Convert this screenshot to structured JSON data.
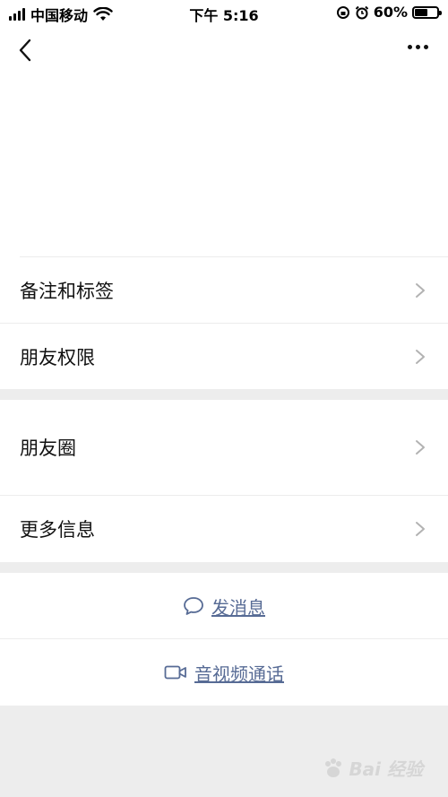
{
  "status_bar": {
    "carrier": "中国移动",
    "time": "下午 5:16",
    "battery": "60%",
    "battery_level": 0.6,
    "icons": [
      "signal-icon",
      "wifi-icon",
      "rotation-lock-icon",
      "alarm-icon",
      "battery-icon"
    ]
  },
  "nav": {
    "back_icon": "chevron-left-icon",
    "more_icon": "more-dots-icon"
  },
  "menu_group_1": [
    {
      "label": "备注和标签"
    },
    {
      "label": "朋友权限"
    }
  ],
  "menu_group_2": [
    {
      "label": "朋友圈"
    },
    {
      "label": "更多信息"
    }
  ],
  "actions": {
    "message": {
      "label": "发消息",
      "icon": "chat-bubble-icon"
    },
    "call": {
      "label": "音视频通话",
      "icon": "video-camera-icon"
    }
  },
  "colors": {
    "link": "#576b95",
    "background": "#ededed",
    "card": "#ffffff"
  },
  "watermark": {
    "text": "Bai 经验"
  }
}
